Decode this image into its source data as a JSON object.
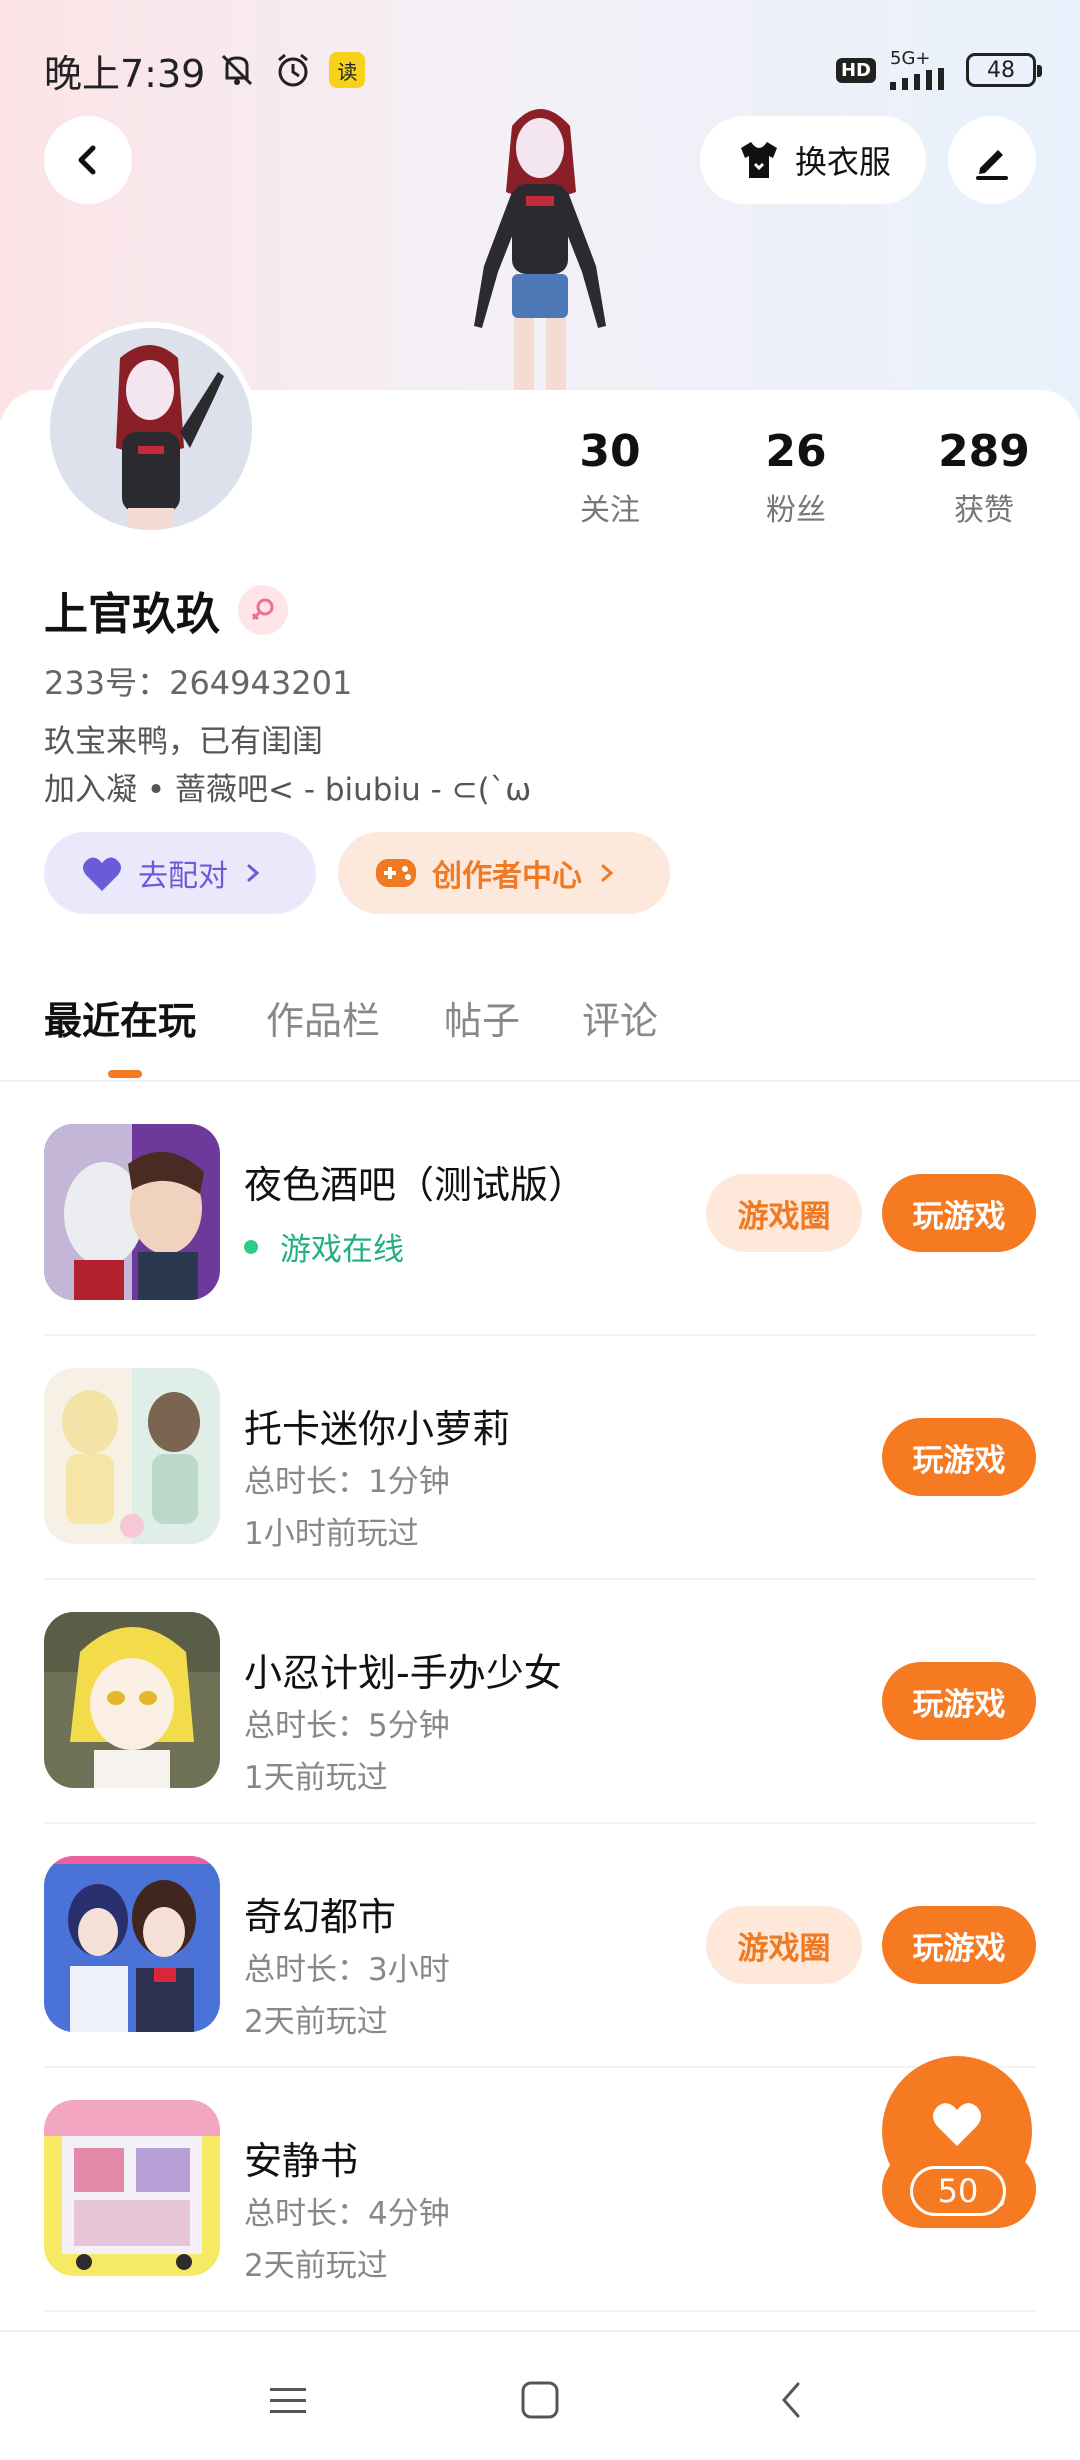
{
  "status_bar": {
    "time": "晚上7:39",
    "read_badge": "读",
    "hd": "HD",
    "network": "5G+",
    "battery": "48"
  },
  "header": {
    "wardrobe_label": "换衣服"
  },
  "profile": {
    "stats": [
      {
        "value": "30",
        "label": "关注"
      },
      {
        "value": "26",
        "label": "粉丝"
      },
      {
        "value": "289",
        "label": "获赞"
      }
    ],
    "username": "上官玖玖",
    "uid": "233号：264943201",
    "bio_line1": "玖宝来鸭，已有闺闺",
    "bio_line2": "加入凝 • 蔷薇吧< - biubiu - ⊂(`ω",
    "match_button": "去配对",
    "creator_button": "创作者中心"
  },
  "tabs": [
    {
      "label": "最近在玩",
      "active": true
    },
    {
      "label": "作品栏",
      "active": false
    },
    {
      "label": "帖子",
      "active": false
    },
    {
      "label": "评论",
      "active": false
    }
  ],
  "games": [
    {
      "title": "夜色酒吧（测试版）",
      "status": "游戏在线",
      "meta1": "",
      "meta2": "",
      "has_circle": true
    },
    {
      "title": "托卡迷你小萝莉",
      "status": "",
      "meta1": "总时长：1分钟",
      "meta2": "1小时前玩过",
      "has_circle": false
    },
    {
      "title": "小忍计划-手办少女",
      "status": "",
      "meta1": "总时长：5分钟",
      "meta2": "1天前玩过",
      "has_circle": false
    },
    {
      "title": "奇幻都市",
      "status": "",
      "meta1": "总时长：3小时",
      "meta2": "2天前玩过",
      "has_circle": true
    },
    {
      "title": "安静书",
      "status": "",
      "meta1": "总时长：4分钟",
      "meta2": "2天前玩过",
      "has_circle": false
    }
  ],
  "buttons": {
    "play": "玩游戏",
    "circle": "游戏圈"
  },
  "like_fab": {
    "count": "50"
  },
  "colors": {
    "accent": "#f57a21",
    "accent_soft": "#fde8da",
    "purple": "#6a5bd8",
    "online_green": "#2ecc8a"
  }
}
